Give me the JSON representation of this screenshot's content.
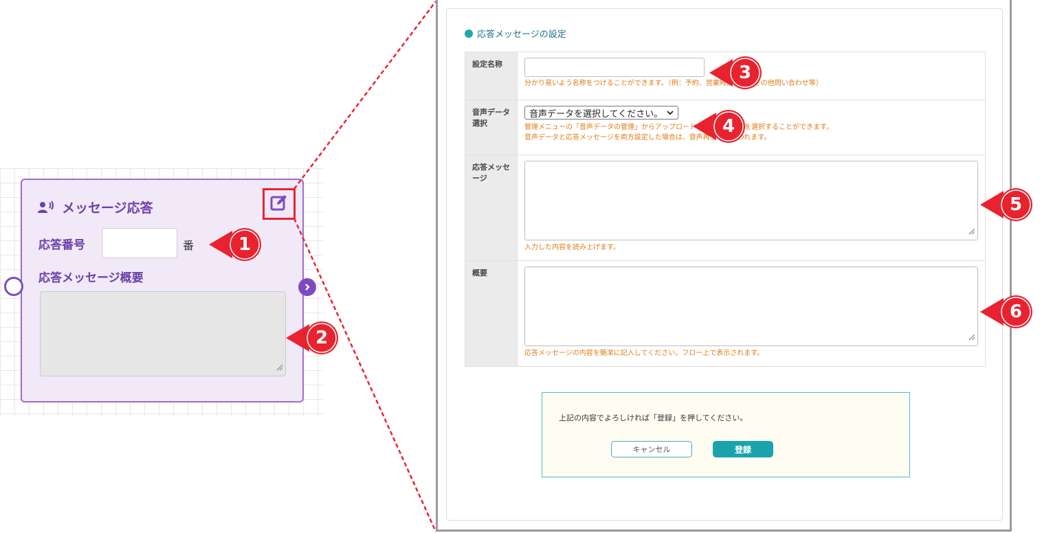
{
  "node": {
    "title": "メッセージ応答",
    "number_label": "応答番号",
    "number_value": "",
    "number_suffix": "番",
    "summary_label": "応答メッセージ概要",
    "summary_value": ""
  },
  "callouts": [
    "1",
    "2",
    "3",
    "4",
    "5",
    "6"
  ],
  "form": {
    "section_title": "応答メッセージの設定",
    "rows": {
      "name": {
        "label": "設定名称",
        "value": "",
        "help": "分かり易いよう名称をつけることができます。（例：予約、営業時間案内、その他問い合わせ等）"
      },
      "audio": {
        "label": "音声データ選択",
        "selected": "音声データを選択してください。",
        "help1": "管理メニューの「音声データの管理」からアップロードした音声データを選択することができます。",
        "help2": "音声データと応答メッセージを両方設定した場合は、音声再生のみ行われます。"
      },
      "message": {
        "label": "応答メッセージ",
        "value": "",
        "help": "入力した内容を読み上げます。"
      },
      "summary": {
        "label": "概要",
        "value": "",
        "help": "応答メッセージの内容を簡潔に記入してください。フロー上で表示されます。"
      }
    },
    "confirm": {
      "text": "上記の内容でよろしければ「登録」を押してください。",
      "cancel_label": "キャンセル",
      "register_label": "登録"
    }
  },
  "colors": {
    "node_accent": "#7d4bc1",
    "callout_red": "#e8232f",
    "teal": "#1aa3ab",
    "help_orange": "#e07b14"
  }
}
